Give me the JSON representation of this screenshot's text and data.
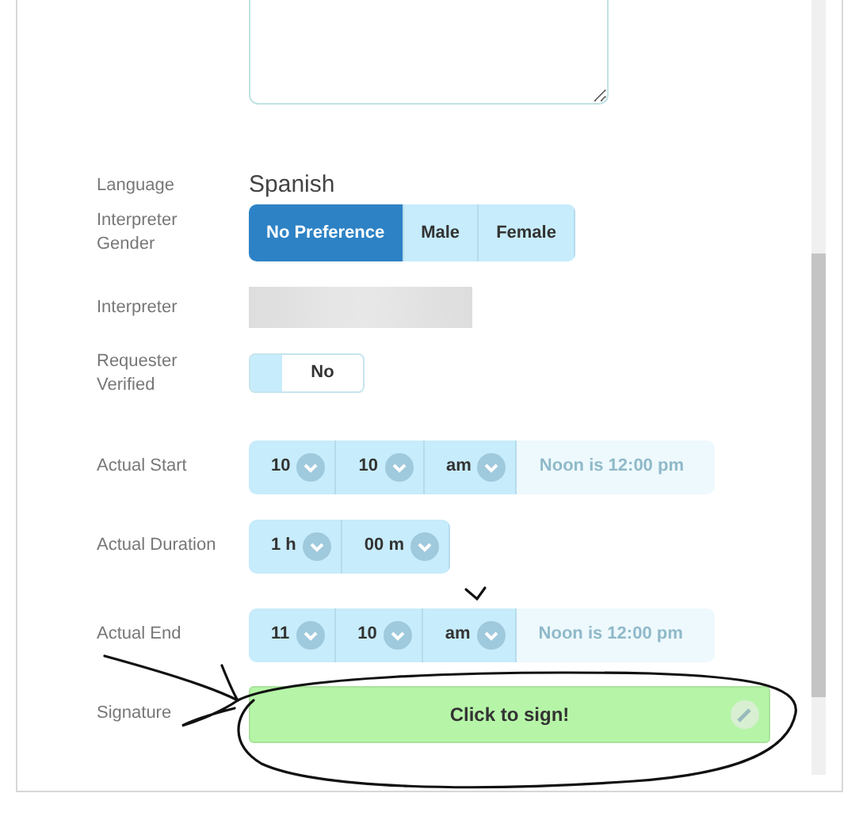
{
  "fields": [
    {
      "kind": "text",
      "label": "Language",
      "value": "Spanish"
    },
    {
      "kind": "segmented",
      "label": "Interpreter Gender",
      "options": [
        {
          "label": "No Preference",
          "selected": true
        },
        {
          "label": "Male",
          "selected": false
        },
        {
          "label": "Female",
          "selected": false
        }
      ]
    },
    {
      "kind": "redacted",
      "label": "Interpreter"
    },
    {
      "kind": "toggle",
      "label": "Requester Verified",
      "value": "No",
      "on": false
    },
    {
      "kind": "time",
      "label": "Actual Start",
      "parts": [
        "10",
        "10",
        "am"
      ],
      "hint": "Noon is 12:00 pm"
    },
    {
      "kind": "time",
      "label": "Actual Duration",
      "parts": [
        "1 h",
        "00 m"
      ]
    },
    {
      "kind": "time",
      "label": "Actual End",
      "parts": [
        "11",
        "10",
        "am"
      ],
      "hint": "Noon is 12:00 pm"
    },
    {
      "kind": "signature",
      "label": "Signature",
      "value": "Click to sign!"
    }
  ]
}
